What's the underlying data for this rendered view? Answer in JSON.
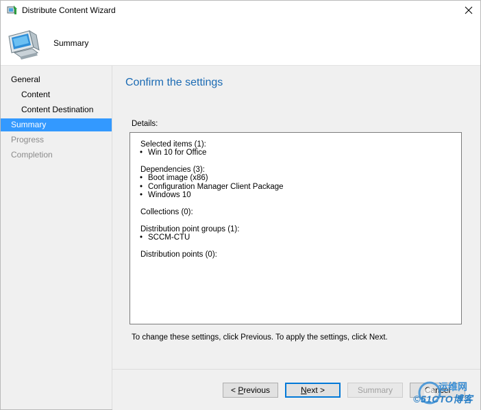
{
  "window": {
    "title": "Distribute Content Wizard",
    "header_title": "Summary"
  },
  "sidebar": {
    "items": [
      {
        "label": "General",
        "level": 0,
        "state": "normal"
      },
      {
        "label": "Content",
        "level": 1,
        "state": "normal"
      },
      {
        "label": "Content Destination",
        "level": 1,
        "state": "normal"
      },
      {
        "label": "Summary",
        "level": 0,
        "state": "selected"
      },
      {
        "label": "Progress",
        "level": 0,
        "state": "disabled"
      },
      {
        "label": "Completion",
        "level": 0,
        "state": "disabled"
      }
    ]
  },
  "main": {
    "title": "Confirm the settings",
    "details_label": "Details:",
    "details": {
      "selected_items_header": "Selected items (1):",
      "selected_items": [
        "Win 10 for Office"
      ],
      "dependencies_header": "Dependencies (3):",
      "dependencies": [
        "Boot image (x86)",
        "Configuration Manager Client Package",
        "Windows 10"
      ],
      "collections_header": "Collections (0):",
      "dp_groups_header": "Distribution point groups (1):",
      "dp_groups": [
        "SCCM-CTU"
      ],
      "dp_header": "Distribution points (0):"
    },
    "instruction": "To change these settings, click Previous. To apply the settings, click Next."
  },
  "footer": {
    "previous_prefix": "< ",
    "previous_accel": "P",
    "previous_rest": "revious",
    "next_accel": "N",
    "next_rest": "ext >",
    "summary_label": "Summary",
    "cancel_label": "Cancel"
  },
  "watermark": {
    "line1": "运维网",
    "line2": "©51CTO博客"
  },
  "colors": {
    "title_blue": "#1a6ab3",
    "selection": "#3399ff",
    "panel_bg": "#f0f0f0"
  },
  "icons": {
    "app": "wizard-app-icon",
    "header": "computer-monitor-icon",
    "close": "close-icon"
  }
}
